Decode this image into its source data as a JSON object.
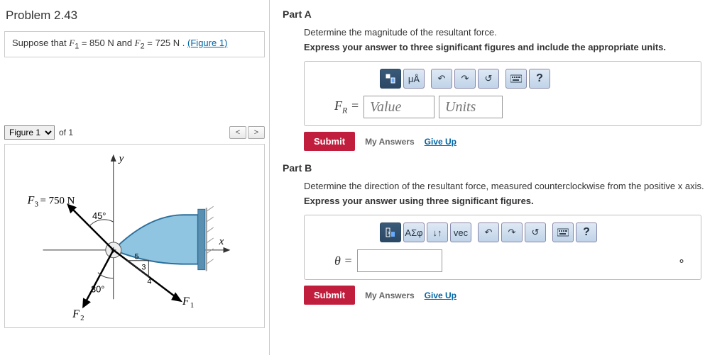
{
  "problem": {
    "title": "Problem 2.43",
    "suppose_pre": "Suppose that ",
    "f1_var": "F",
    "f1_sub": "1",
    "f1_eq": " = 850  N",
    "and": " and ",
    "f2_var": "F",
    "f2_sub": "2",
    "f2_eq": " = 725  N",
    "dot": " . ",
    "figlink": "(Figure 1)"
  },
  "figure": {
    "select": "Figure 1",
    "of": "of 1",
    "prev": "<",
    "next": ">",
    "y": "y",
    "x": "x",
    "f3": "F",
    "f3sub": "3",
    "f3eq": " = 750 N",
    "a45": "45°",
    "a30": "30°",
    "f2v": "F",
    "f2s": "2",
    "f1v": "F",
    "f1s": "1",
    "five": "5",
    "three": "3",
    "four": "4"
  },
  "partA": {
    "title": "Part A",
    "desc": "Determine the magnitude of the resultant force.",
    "bold": "Express your answer to three significant figures and include the appropriate units.",
    "muA": "μÅ",
    "fr_var": "F",
    "fr_sub": "R",
    "eq": " = ",
    "value_ph": "Value",
    "units_ph": "Units",
    "submit": "Submit",
    "myans": "My Answers",
    "giveup": "Give Up",
    "q": "?"
  },
  "partB": {
    "title": "Part B",
    "desc": "Determine the direction of the resultant force, measured counterclockwise from the positive x axis.",
    "bold": "Express your answer using three significant figures.",
    "asf": "ΑΣφ",
    "vec": "vec",
    "theta": "θ",
    "eq": " = ",
    "deg": "∘",
    "submit": "Submit",
    "myans": "My Answers",
    "giveup": "Give Up",
    "q": "?"
  }
}
